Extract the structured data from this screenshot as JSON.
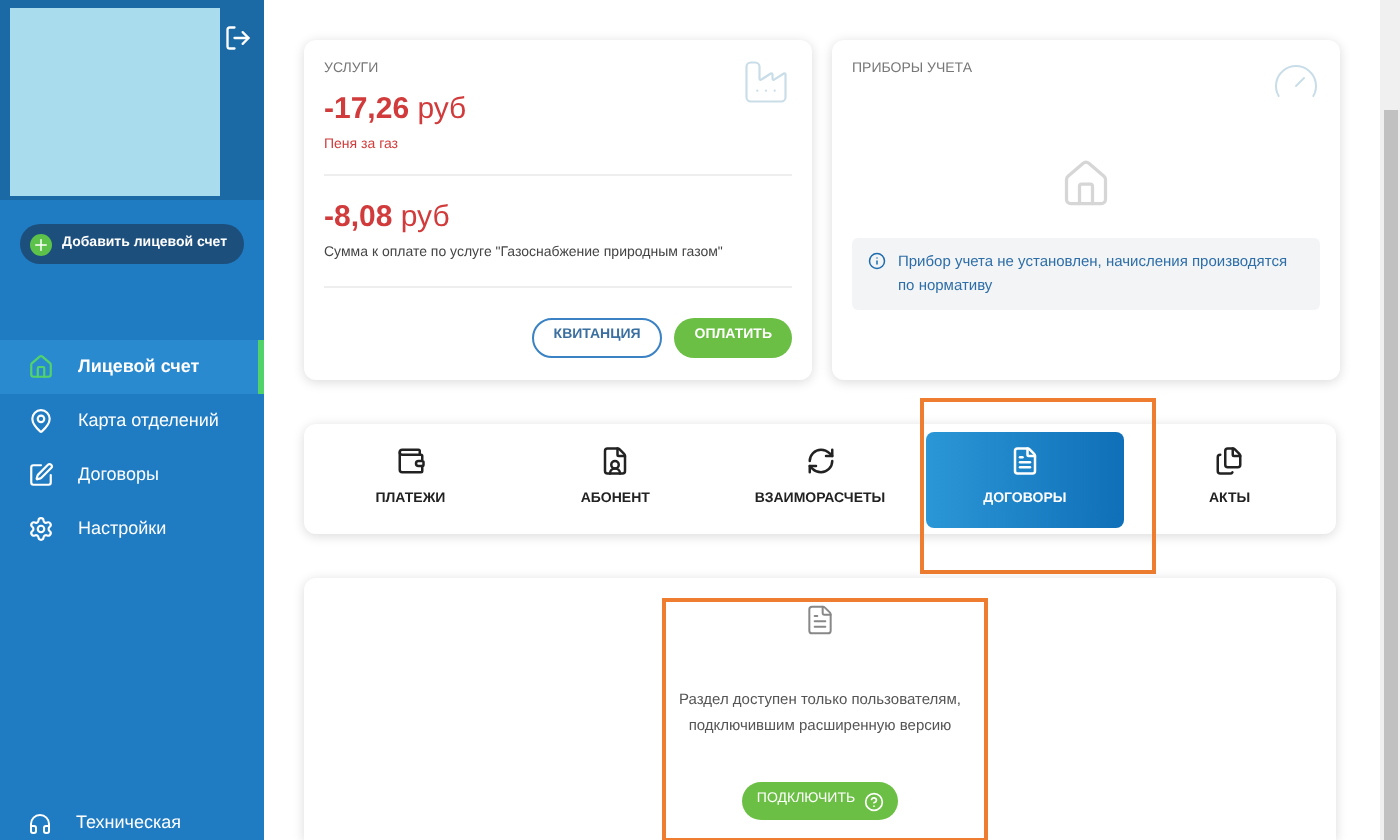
{
  "sidebar": {
    "add_account": "Добавить лицевой счет",
    "items": [
      {
        "label": "Лицевой счет",
        "kind": "home",
        "selected": true
      },
      {
        "label": "Карта отделений",
        "kind": "pin",
        "selected": false
      },
      {
        "label": "Договоры",
        "kind": "edit",
        "selected": false
      },
      {
        "label": "Настройки",
        "kind": "gear",
        "selected": false
      }
    ],
    "support": "Техническая"
  },
  "services": {
    "title": "УСЛУГИ",
    "charges": [
      {
        "amount": "-17,26",
        "unit": "руб",
        "description": "Пеня за газ"
      },
      {
        "amount": "-8,08",
        "unit": "руб",
        "description": "Сумма к оплате по услуге \"Газоснабжение природным газом\""
      }
    ],
    "buttons": [
      {
        "label": "КВИТАНЦИЯ",
        "kind": "outline"
      },
      {
        "label": "ОПЛАТИТЬ",
        "kind": "primary"
      }
    ]
  },
  "meters": {
    "title": "ПРИБОРЫ УЧЕТА",
    "notice": "Прибор учета не установлен, начисления производятся по нормативу"
  },
  "tabs": [
    {
      "label": "ПЛАТЕЖИ",
      "kind": "wallet",
      "selected": false
    },
    {
      "label": "АБОНЕНТ",
      "kind": "subscriber",
      "selected": false
    },
    {
      "label": "ВЗАИМОРАСЧЕТЫ",
      "kind": "sync",
      "selected": false
    },
    {
      "label": "ДОГОВОРЫ",
      "kind": "doc",
      "selected": true
    },
    {
      "label": "АКТЫ",
      "kind": "docs",
      "selected": false
    }
  ],
  "locked": {
    "message": "Раздел доступен только пользователям, подключившим расширенную версию",
    "button": "ПОДКЛЮЧИТЬ"
  }
}
